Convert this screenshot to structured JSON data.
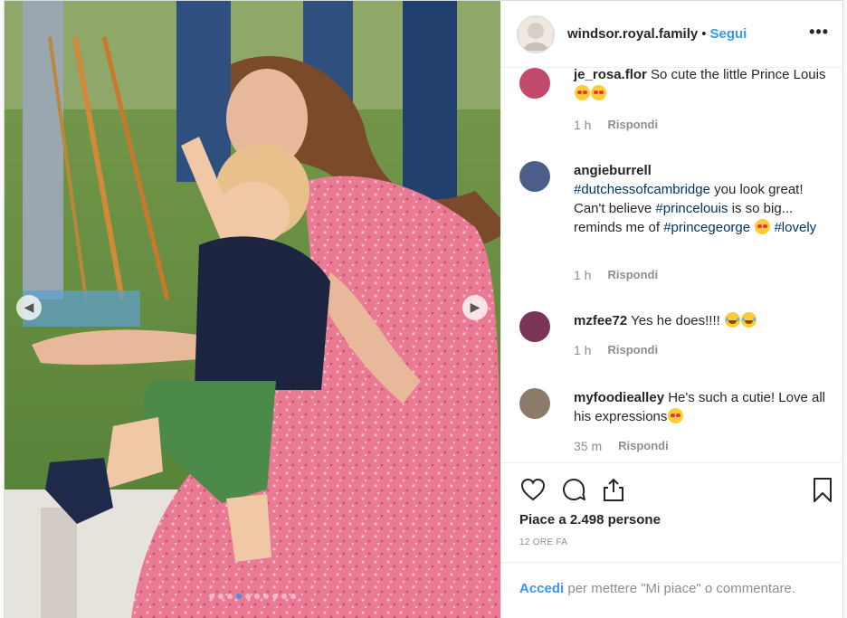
{
  "post": {
    "owner": "windsor.royal.family",
    "bullet": "•",
    "follow_label": "Segui",
    "more_label": "•••"
  },
  "comments": [
    {
      "user": "je_rosa.flor",
      "text": "So cute the little Prince Louis",
      "emojis": [
        "heart-eyes-emoji",
        "heart-eyes-emoji"
      ],
      "time": "1 h",
      "reply": "Rispondi"
    },
    {
      "user": "angieburrell",
      "parts": [
        "#dutchessofcambridge",
        " you look great! Can't believe ",
        "#princelouis",
        " is so big... reminds me of ",
        "#princegeorge",
        " ",
        "#lovely"
      ],
      "emojis": [
        "heart-eyes-emoji"
      ],
      "time": "1 h",
      "reply": "Rispondi"
    },
    {
      "user": "mzfee72",
      "text": "Yes he does!!!!",
      "emojis": [
        "tears-of-joy-emoji",
        "tears-of-joy-emoji"
      ],
      "time": "1 h",
      "reply": "Rispondi"
    },
    {
      "user": "myfoodiealley",
      "text": "He's such a cutie! Love all his expressions",
      "emojis": [
        "heart-eyes-emoji"
      ],
      "time": "35 m",
      "reply": "Rispondi"
    }
  ],
  "actions": {
    "likes": "Piace a 2.498 persone",
    "time": "12 ORE FA",
    "icons": [
      "heart-icon",
      "comment-icon",
      "share-icon",
      "bookmark-icon"
    ]
  },
  "login": {
    "link": "Accedi",
    "text": " per mettere \"Mi piace\" o commentare."
  },
  "carousel": {
    "total": 10,
    "active": 3
  },
  "colors": {
    "link": "#3897f0",
    "hashtag": "#003569",
    "muted": "#8e8e8e",
    "dress": "#e9758f"
  }
}
